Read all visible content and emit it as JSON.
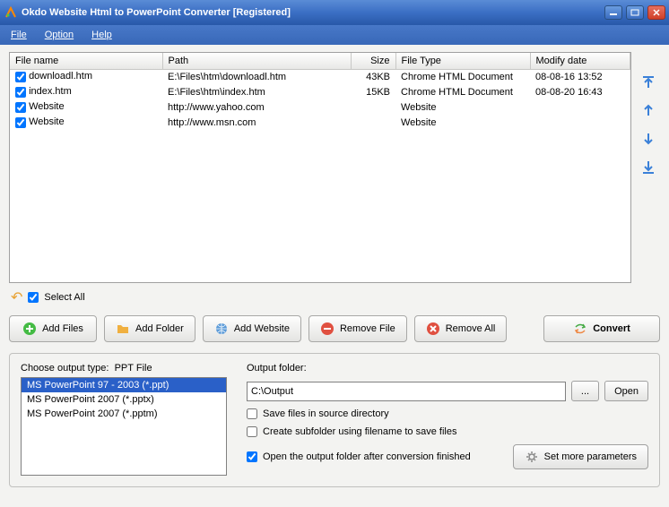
{
  "title": "Okdo Website Html to PowerPoint Converter  [Registered]",
  "menu": {
    "file": "File",
    "option": "Option",
    "help": "Help"
  },
  "table": {
    "headers": {
      "name": "File name",
      "path": "Path",
      "size": "Size",
      "type": "File Type",
      "date": "Modify date"
    },
    "rows": [
      {
        "name": "downloadl.htm",
        "path": "E:\\Files\\htm\\downloadl.htm",
        "size": "43KB",
        "type": "Chrome HTML Document",
        "date": "08-08-16 13:52"
      },
      {
        "name": "index.htm",
        "path": "E:\\Files\\htm\\index.htm",
        "size": "15KB",
        "type": "Chrome HTML Document",
        "date": "08-08-20 16:43"
      },
      {
        "name": "Website",
        "path": "http://www.yahoo.com",
        "size": "",
        "type": "Website",
        "date": ""
      },
      {
        "name": "Website",
        "path": "http://www.msn.com",
        "size": "",
        "type": "Website",
        "date": ""
      }
    ]
  },
  "selectAll": "Select All",
  "buttons": {
    "addFiles": "Add Files",
    "addFolder": "Add Folder",
    "addWebsite": "Add Website",
    "removeFile": "Remove File",
    "removeAll": "Remove All",
    "convert": "Convert"
  },
  "outputType": {
    "label": "Choose output type:",
    "current": "PPT File",
    "options": [
      "MS PowerPoint 97 - 2003 (*.ppt)",
      "MS PowerPoint 2007 (*.pptx)",
      "MS PowerPoint 2007 (*.pptm)"
    ]
  },
  "outputFolder": {
    "label": "Output folder:",
    "value": "C:\\Output",
    "browse": "...",
    "open": "Open"
  },
  "options": {
    "saveSource": "Save files in source directory",
    "subfolder": "Create subfolder using filename to save files",
    "openAfter": "Open the output folder after conversion finished"
  },
  "moreParams": "Set more parameters"
}
